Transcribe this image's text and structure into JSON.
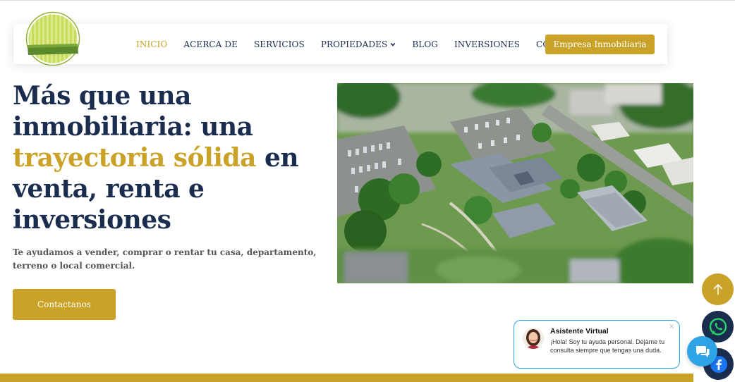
{
  "nav": {
    "items": [
      {
        "label": "INICIO",
        "active": true
      },
      {
        "label": "ACERCA DE",
        "active": false
      },
      {
        "label": "SERVICIOS",
        "active": false
      },
      {
        "label": "PROPIEDADES",
        "active": false,
        "dropdown": true
      },
      {
        "label": "BLOG",
        "active": false
      },
      {
        "label": "INVERSIONES",
        "active": false
      },
      {
        "label": "CONTACTO",
        "active": false
      }
    ],
    "cta_label": "Empresa Inmobiliaria"
  },
  "hero": {
    "title_part1": "Más que una inmobiliaria: una ",
    "title_highlight": "trayectoria sólida",
    "title_part2": " en venta, renta e inversiones",
    "subtitle": "Te ayudamos a vender, comprar o rentar tu casa, departamento, terreno o local comercial.",
    "button_label": "Contactanos"
  },
  "chat": {
    "title": "Asistente Virtual",
    "message": "¡Hola! Soy tu ayuda personal. Dejame tu consulta siempre que tengas una duda.",
    "close": "×"
  },
  "icons": {
    "logo": "logo-icon",
    "scroll_top": "arrow-up-icon",
    "whatsapp": "whatsapp-icon",
    "facebook": "facebook-icon",
    "chat": "chat-icon"
  },
  "colors": {
    "brand_gold": "#c9a227",
    "navy": "#1b2d4f",
    "chat_blue": "#2ea3e6"
  }
}
